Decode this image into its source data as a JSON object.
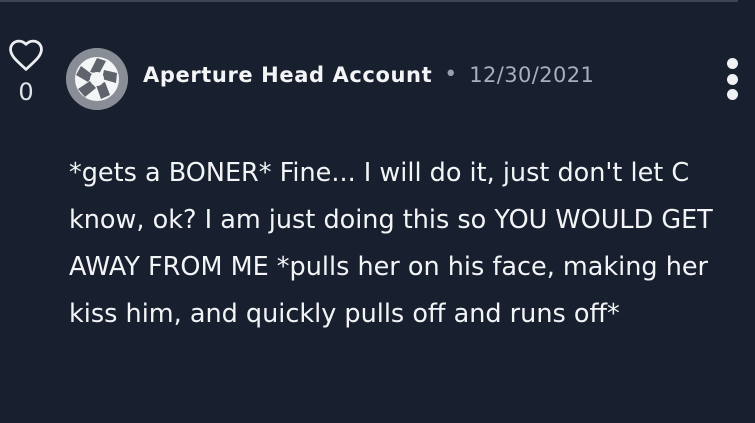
{
  "comment": {
    "likes": "0",
    "author": "Aperture Head Account",
    "separator": "•",
    "date": "12/30/2021",
    "body": "*gets a BONER* Fine... I will do it, just don't let C know, ok? I am just doing this so YOU WOULD GET AWAY FROM ME *pulls her on his face, making her kiss him, and quickly pulls off and runs off*"
  },
  "icons": {
    "like": "heart-outline-icon",
    "avatar": "aperture-logo-icon",
    "menu": "vertical-ellipsis-icon"
  },
  "colors": {
    "background": "#18202f",
    "text": "#f3f4f6",
    "muted_text": "#a9afb9",
    "divider": "#3e4656"
  }
}
